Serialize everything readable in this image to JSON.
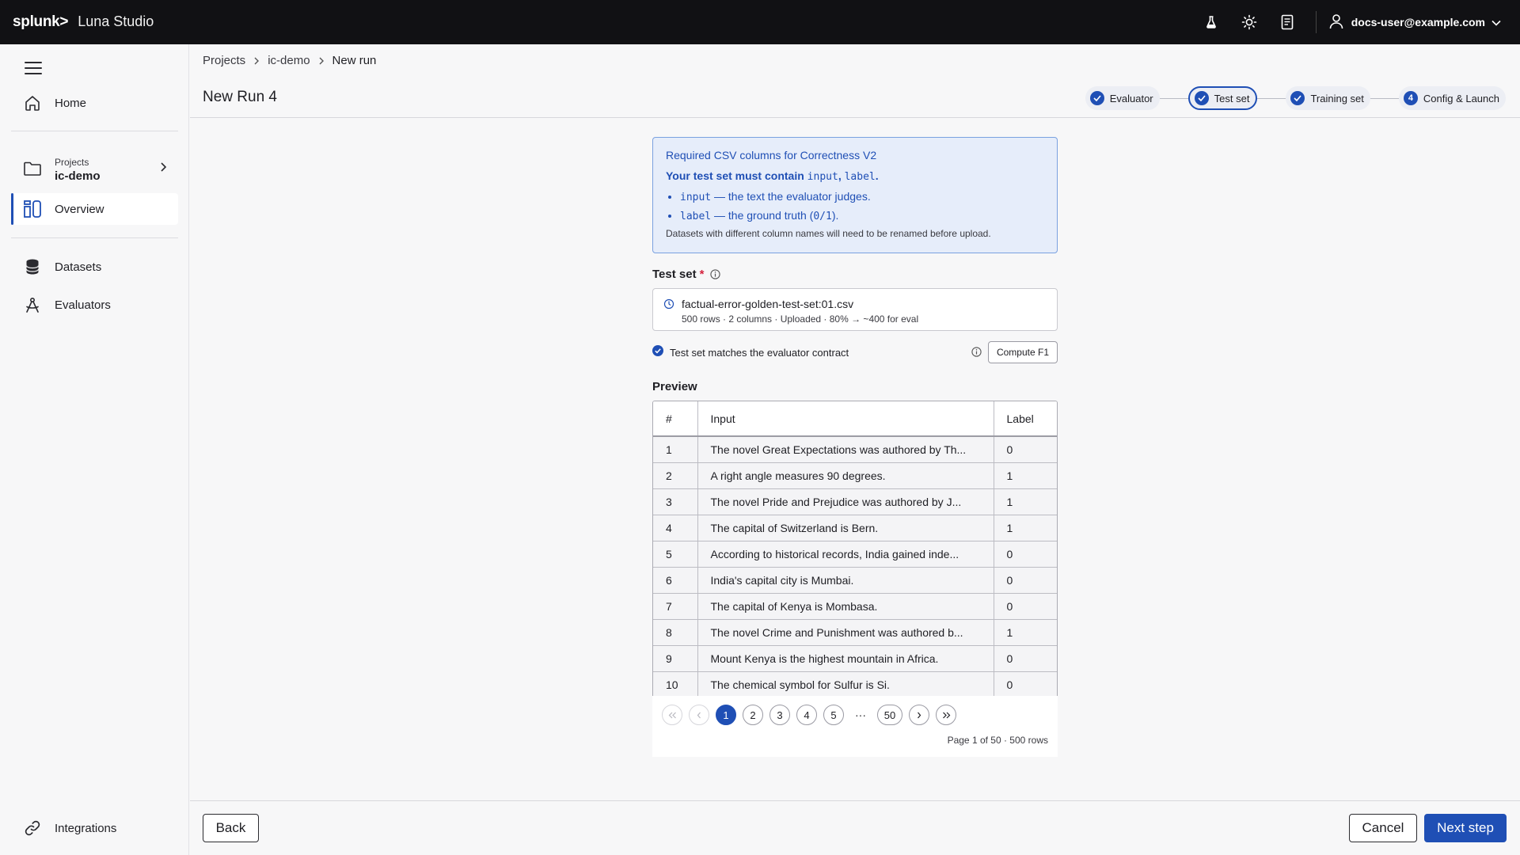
{
  "topbar": {
    "brand": "splunk>",
    "product": "Luna Studio",
    "icons": [
      "flask-icon",
      "sun-icon",
      "docs-icon",
      "user-icon"
    ],
    "user_email": "docs-user@example.com"
  },
  "sidebar": {
    "home": "Home",
    "projects_small": "Projects",
    "project_name": "ic-demo",
    "overview": "Overview",
    "datasets": "Datasets",
    "evaluators": "Evaluators",
    "integrations": "Integrations"
  },
  "breadcrumb": [
    "Projects",
    "ic-demo",
    "New run"
  ],
  "page_title": "New Run 4",
  "stepper": {
    "steps": [
      {
        "label": "Evaluator",
        "state": "done"
      },
      {
        "label": "Test set",
        "state": "current"
      },
      {
        "label": "Training set",
        "state": "done"
      },
      {
        "label": "Config & Launch",
        "state": "numbered",
        "number": "4"
      }
    ]
  },
  "info_box": {
    "title": "Required CSV columns for Correctness V2",
    "sub_prefix": "Your test set must contain ",
    "col_input": "input",
    "comma": ", ",
    "col_label": "label",
    "period": ".",
    "bullets": [
      {
        "code": "input",
        "text": " — the text the evaluator judges."
      },
      {
        "code": "label",
        "text_prefix": " — the ground truth (",
        "code2": "0/1",
        "text_suffix": ")."
      }
    ],
    "note": "Datasets with different column names will need to be renamed before upload."
  },
  "test_set": {
    "label": "Test set",
    "required_mark": "*",
    "file_name": "factual-error-golden-test-set:01.csv",
    "file_meta": "500 rows · 2 columns · Uploaded · 80% → ~400 for eval",
    "contract_text": "Test set matches the evaluator contract",
    "compute_label": "Compute F1"
  },
  "preview": {
    "label": "Preview",
    "headers": [
      "#",
      "Input",
      "Label"
    ],
    "rows": [
      [
        "1",
        "The novel Great Expectations was authored by Th...",
        "0"
      ],
      [
        "2",
        "A right angle measures 90 degrees.",
        "1"
      ],
      [
        "3",
        "The novel Pride and Prejudice was authored by J...",
        "1"
      ],
      [
        "4",
        "The capital of Switzerland is Bern.",
        "1"
      ],
      [
        "5",
        "According to historical records, India gained inde...",
        "0"
      ],
      [
        "6",
        "India's capital city is Mumbai.",
        "0"
      ],
      [
        "7",
        "The capital of Kenya is Mombasa.",
        "0"
      ],
      [
        "8",
        "The novel Crime and Punishment was authored b...",
        "1"
      ],
      [
        "9",
        "Mount Kenya is the highest mountain in Africa.",
        "0"
      ],
      [
        "10",
        "The chemical symbol for Sulfur is Si.",
        "0"
      ]
    ]
  },
  "pagination": {
    "pages": [
      "1",
      "2",
      "3",
      "4",
      "5"
    ],
    "ellipsis": "···",
    "last_page": "50",
    "current_page": "1",
    "status": "Page 1 of 50 · 500 rows"
  },
  "footer": {
    "back": "Back",
    "cancel": "Cancel",
    "next": "Next step"
  },
  "colors": {
    "accent": "#1f4fb5",
    "topbar_bg": "#111114",
    "info_bg": "#e6edfa",
    "required": "#d4213d"
  }
}
